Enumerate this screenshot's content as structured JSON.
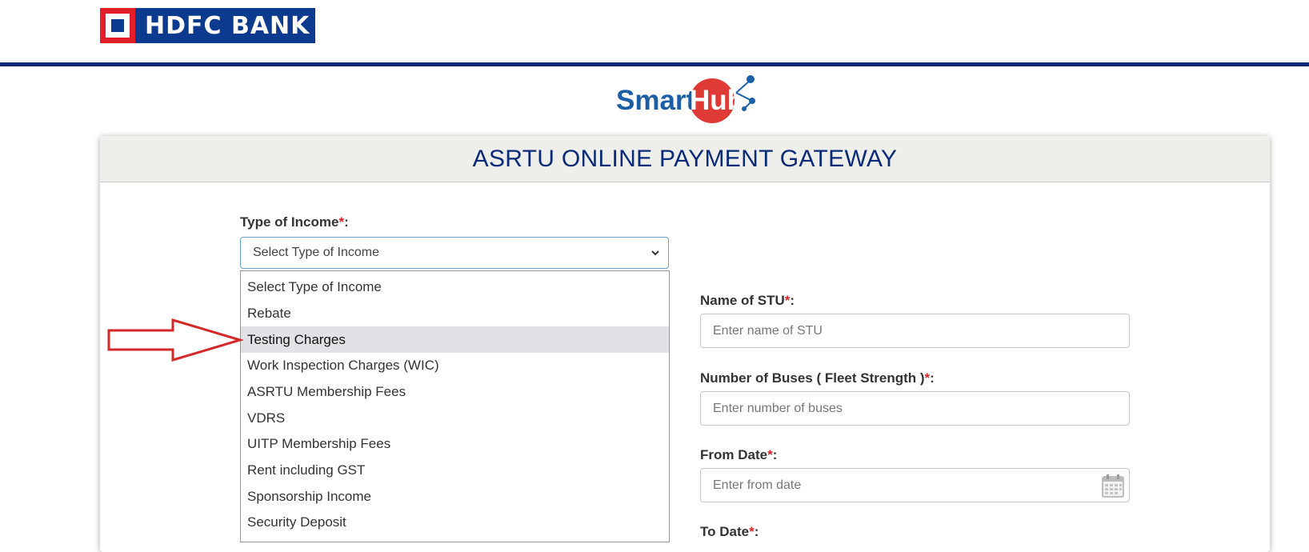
{
  "brand": {
    "bank_name": "HDFC BANK",
    "smarthub_smart": "Smart",
    "smarthub_hub": "Hub"
  },
  "page": {
    "title": "ASRTU ONLINE PAYMENT GATEWAY"
  },
  "income": {
    "label": "Type of Income",
    "selected": "Select Type of Income",
    "options": [
      "Select Type of Income",
      "Rebate",
      "Testing Charges",
      "Work Inspection Charges (WIC)",
      "ASRTU Membership Fees",
      "VDRS",
      "UITP Membership Fees",
      "Rent including GST",
      "Sponsorship Income",
      "Security Deposit"
    ],
    "highlighted_index": 2
  },
  "form": {
    "required_mark": "*",
    "colon": ":",
    "stu_label": "Name of STU",
    "stu_placeholder": "Enter name of STU",
    "buses_label": "Number of Buses ( Fleet Strength )",
    "buses_placeholder": "Enter number of buses",
    "from_label": "From Date",
    "from_placeholder": "Enter from date",
    "to_label": "To Date"
  },
  "icons": {
    "dropdown": "chevron-down-icon",
    "calendar": "calendar-icon",
    "annotation": "red-arrow-icon"
  },
  "colors": {
    "brand_blue": "#0b2b78",
    "hdfc_red": "#e3202a",
    "highlight": "#e1e1e6"
  }
}
